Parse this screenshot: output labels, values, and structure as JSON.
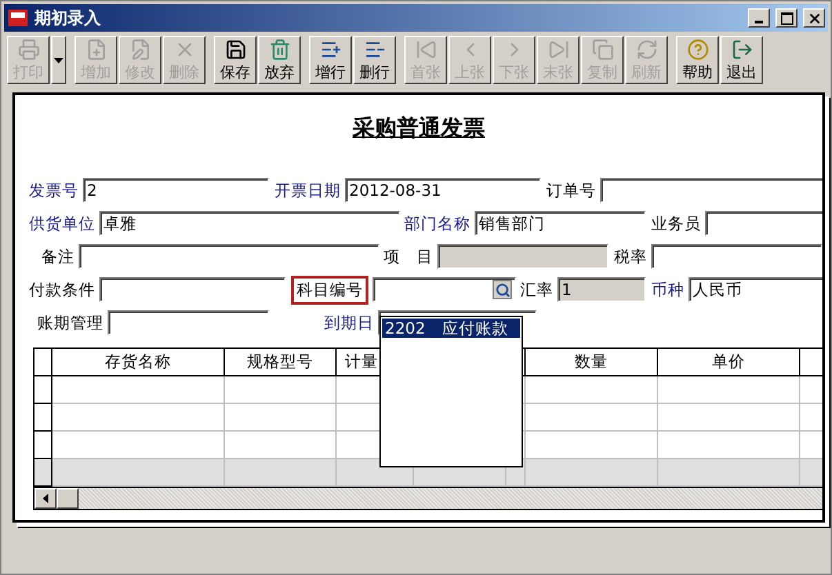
{
  "window": {
    "title": "期初录入"
  },
  "toolbar": [
    [
      {
        "label": "打印",
        "disabled": true,
        "dropdown": true
      }
    ],
    [
      {
        "label": "增加",
        "disabled": true,
        "dropdown": false
      },
      {
        "label": "修改",
        "disabled": true,
        "dropdown": false
      },
      {
        "label": "删除",
        "disabled": true,
        "dropdown": false
      }
    ],
    [
      {
        "label": "保存",
        "disabled": false,
        "dropdown": false
      },
      {
        "label": "放弃",
        "disabled": false,
        "dropdown": false
      }
    ],
    [
      {
        "label": "增行",
        "disabled": false,
        "dropdown": false
      },
      {
        "label": "删行",
        "disabled": false,
        "dropdown": false
      }
    ],
    [
      {
        "label": "首张",
        "disabled": true,
        "dropdown": false
      },
      {
        "label": "上张",
        "disabled": true,
        "dropdown": false
      },
      {
        "label": "下张",
        "disabled": true,
        "dropdown": false
      },
      {
        "label": "末张",
        "disabled": true,
        "dropdown": false
      },
      {
        "label": "复制",
        "disabled": true,
        "dropdown": false
      },
      {
        "label": "刷新",
        "disabled": true,
        "dropdown": false
      }
    ],
    [
      {
        "label": "帮助",
        "disabled": false,
        "dropdown": false
      },
      {
        "label": "退出",
        "disabled": false,
        "dropdown": false
      }
    ]
  ],
  "form": {
    "title": "采购普通发票",
    "fields": [
      {
        "label": "发票号",
        "required": true,
        "value": "2",
        "kind": "text"
      },
      {
        "label": "开票日期",
        "required": true,
        "value": "2012-08-31",
        "kind": "text"
      },
      {
        "label": "订单号",
        "required": false,
        "kind": "text"
      },
      {
        "label": "供货单位",
        "required": true,
        "value": "卓雅",
        "kind": "text"
      },
      {
        "label": "部门名称",
        "required": true,
        "value": "销售部门",
        "kind": "text"
      },
      {
        "label": "业务员",
        "required": false,
        "kind": "text"
      },
      {
        "label": "备注",
        "required": false,
        "kind": "text"
      },
      {
        "label": "项　目",
        "required": false,
        "kind": "readonly"
      },
      {
        "label": "税率",
        "required": false,
        "kind": "text"
      },
      {
        "label": "付款条件",
        "required": false,
        "kind": "text"
      },
      {
        "label": "科目编号",
        "required": false,
        "kind": "lookup",
        "highlighted": true
      },
      {
        "label": "汇率",
        "required": false,
        "value": "1",
        "kind": "readonly"
      },
      {
        "label": "币种",
        "required": true,
        "value": "人民币",
        "kind": "text"
      },
      {
        "label": "账期管理",
        "required": false,
        "kind": "text"
      },
      {
        "label": "到期日",
        "required": true,
        "kind": "text"
      }
    ]
  },
  "grid": {
    "columns": [
      {
        "label": "存货名称",
        "cut": false
      },
      {
        "label": "规格型号",
        "cut": false
      },
      {
        "label": "计量",
        "cut": true
      },
      {
        "label": "数量",
        "cut": false
      },
      {
        "label": "单价",
        "cut": false
      }
    ]
  },
  "dropdown": {
    "items": [
      {
        "code": "2202",
        "name": "应付账款",
        "selected": true
      }
    ]
  }
}
